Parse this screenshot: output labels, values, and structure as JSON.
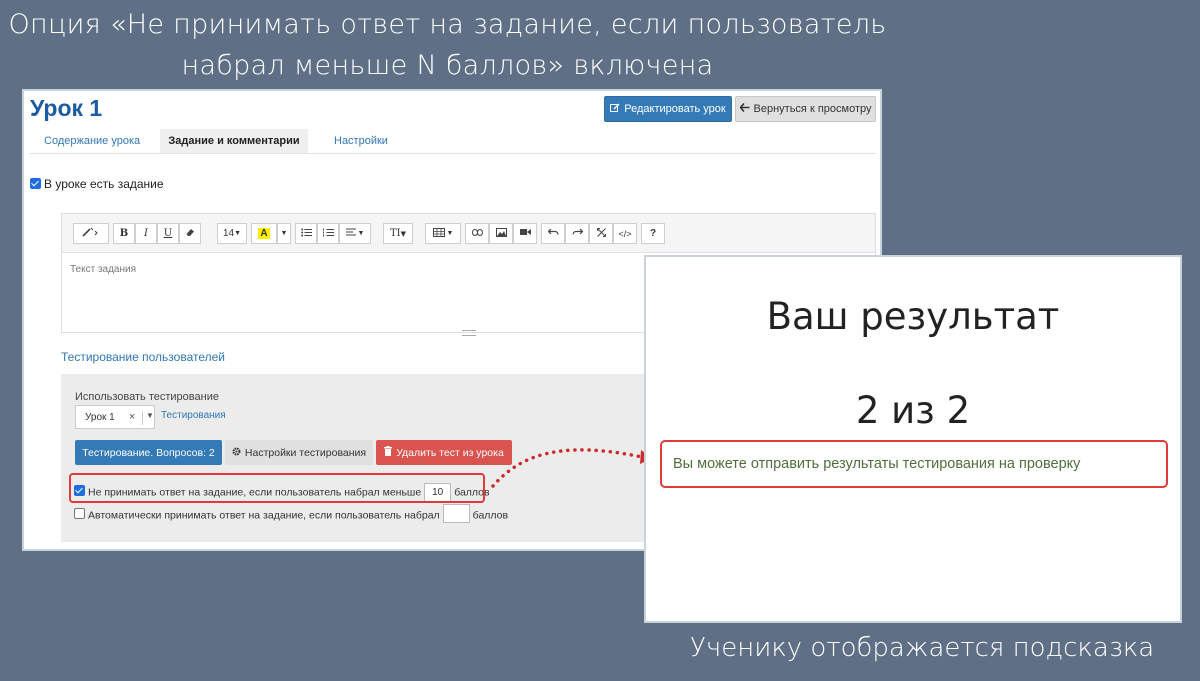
{
  "captions": {
    "top_line1": "Опция «Не принимать ответ на задание, если пользователь",
    "top_line2": "набрал меньше N баллов» включена",
    "bottom": "Ученику отображается подсказка"
  },
  "lesson": {
    "title": "Урок 1",
    "edit_button": "Редактировать урок",
    "back_button": "Вернуться к просмотру",
    "tabs": [
      "Содержание урока",
      "Задание и комментарии",
      "Настройки"
    ],
    "active_tab": "Задание и комментарии",
    "has_task_label": "В уроке есть задание",
    "has_task_checked": true
  },
  "editor": {
    "toolbar": {
      "font_size": "14",
      "text_style": "TI",
      "help": "?",
      "bold": "B",
      "italic": "I",
      "underline": "U",
      "highlight": "A"
    },
    "placeholder": "Текст задания"
  },
  "testing": {
    "section_title": "Тестирование пользователей",
    "use_label": "Использовать тестирование",
    "selected_test": "Урок 1",
    "link": "Тестирования",
    "questions_button": "Тестирование. Вопросов: 2",
    "settings_button": "Настройки тестирования",
    "delete_button": "Удалить тест из урока",
    "option_reject": {
      "label": "Не принимать ответ на задание, если пользователь набрал меньше",
      "value": "10",
      "unit": "баллов",
      "checked": true
    },
    "option_auto": {
      "label": "Автоматически принимать ответ на задание, если пользователь набрал",
      "value": "",
      "unit": "баллов",
      "checked": false
    }
  },
  "result": {
    "title": "Ваш результат",
    "score": "2 из 2",
    "hint": "Вы можете отправить результаты тестирования на проверку"
  },
  "colors": {
    "background": "#5f7086",
    "accent_red": "#e03a3a",
    "primary_blue": "#337ab7",
    "danger": "#d9534f",
    "hint_green": "#4f6f3a"
  }
}
